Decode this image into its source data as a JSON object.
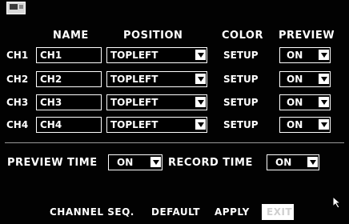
{
  "headers": {
    "name": "NAME",
    "position": "POSITION",
    "color": "COLOR",
    "preview": "PREVIEW"
  },
  "channels": [
    {
      "label": "CH1",
      "name": "CH1",
      "position": "TOPLEFT",
      "color": "SETUP",
      "preview": "ON"
    },
    {
      "label": "CH2",
      "name": "CH2",
      "position": "TOPLEFT",
      "color": "SETUP",
      "preview": "ON"
    },
    {
      "label": "CH3",
      "name": "CH3",
      "position": "TOPLEFT",
      "color": "SETUP",
      "preview": "ON"
    },
    {
      "label": "CH4",
      "name": "CH4",
      "position": "TOPLEFT",
      "color": "SETUP",
      "preview": "ON"
    }
  ],
  "preview_time": {
    "label": "PREVIEW TIME",
    "value": "ON"
  },
  "record_time": {
    "label": "RECORD TIME",
    "value": "ON"
  },
  "buttons": {
    "channel_seq": "CHANNEL SEQ.",
    "default": "DEFAULT",
    "apply": "APPLY",
    "exit": "EXIT"
  },
  "icons": {
    "top": "menu-icon",
    "dropdown": "dropdown-arrow-icon",
    "cursor": "mouse-pointer-icon"
  },
  "colors": {
    "background": "#000000",
    "text": "#ffffff",
    "highlight": "#ffffff"
  }
}
